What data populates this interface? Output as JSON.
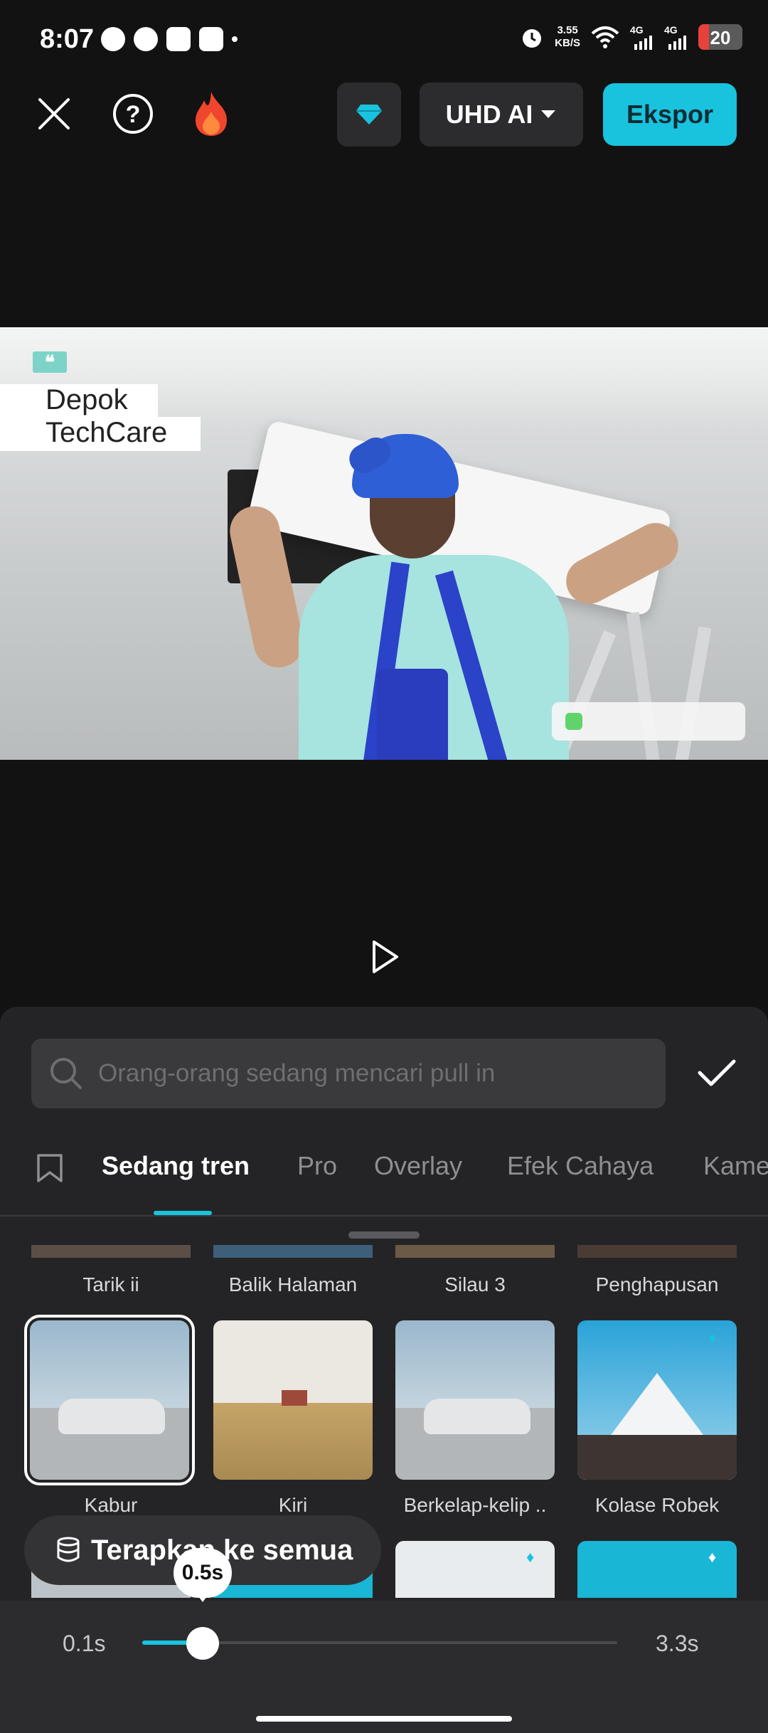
{
  "status_bar": {
    "time": "8:07",
    "net_speed": "3.55",
    "net_unit": "KB/S",
    "sig1": "4G",
    "sig2": "4G",
    "battery": "20"
  },
  "toolbar": {
    "quality_label": "UHD AI",
    "export_label": "Ekspor"
  },
  "video": {
    "caption_line1": "Depok",
    "caption_line2": "TechCare"
  },
  "search": {
    "placeholder": "Orang-orang sedang mencari pull in"
  },
  "tabs": [
    "Sedang tren",
    "Pro",
    "Overlay",
    "Efek Cahaya",
    "Kame"
  ],
  "effects": {
    "row1": [
      "Tarik ii",
      "Balik Halaman",
      "Silau 3",
      "Penghapusan"
    ],
    "row2": [
      "Kabur",
      "Kiri",
      "Berkelap-kelip ..",
      "Kolase Robek"
    ]
  },
  "apply_all_label": "Terapkan ke semua",
  "duration": {
    "min": "0.1s",
    "max": "3.3s",
    "current": "0.5s",
    "fraction": 0.125
  },
  "colors": {
    "accent": "#19c3de",
    "panel": "#242426"
  }
}
